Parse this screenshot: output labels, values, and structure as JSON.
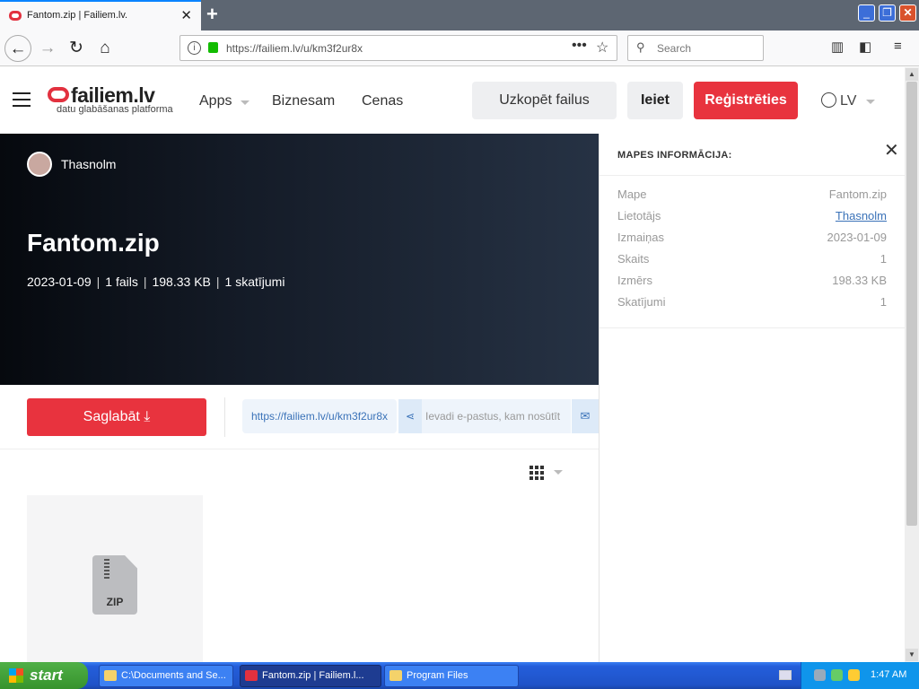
{
  "browser": {
    "tab_title": "Fantom.zip | Failiem.lv.",
    "tab_close": "✕",
    "new_tab": "+",
    "window_buttons": {
      "minimize": "_",
      "maximize": "❐",
      "close": "✕"
    },
    "url": "https://failiem.lv/u/km3f2ur8x",
    "search_placeholder": "Search",
    "page_actions": "•••"
  },
  "header": {
    "logo_name": "failiem.lv",
    "logo_tagline": "datu glabāšanas platforma",
    "nav": [
      "Apps",
      "Biznesam",
      "Cenas"
    ],
    "upload_button": "Uzkopēt failus",
    "login_button": "Ieiet",
    "register_button": "Reģistrēties",
    "language": "LV"
  },
  "hero": {
    "username": "Thasnolm",
    "filename": "Fantom.zip",
    "date": "2023-01-09",
    "file_count": "1 fails",
    "size": "198.33 KB",
    "views": "1 skatījumi"
  },
  "actions": {
    "save_button": "Saglabāt",
    "share_link": "https://failiem.lv/u/km3f2ur8x",
    "email_placeholder": "Ievadi e-pastus, kam nosūtīt"
  },
  "file": {
    "type_label": "ZIP"
  },
  "panel": {
    "title": "MAPES INFORMĀCIJA:",
    "close": "✕",
    "rows": [
      {
        "label": "Mape",
        "value": "Fantom.zip"
      },
      {
        "label": "Lietotājs",
        "value": "Thasnolm"
      },
      {
        "label": "Izmaiņas",
        "value": "2023-01-09"
      },
      {
        "label": "Skaits",
        "value": "1"
      },
      {
        "label": "Izmērs",
        "value": "198.33 KB"
      },
      {
        "label": "Skatījumi",
        "value": "1"
      }
    ]
  },
  "taskbar": {
    "start": "start",
    "tasks": [
      "C:\\Documents and Se...",
      "Fantom.zip | Failiem.l...",
      "Program Files"
    ],
    "clock": "1:47 AM"
  },
  "colors": {
    "brand_red": "#e8333e",
    "link_blue": "#3a72b8",
    "taskbar_blue": "#245edb"
  }
}
